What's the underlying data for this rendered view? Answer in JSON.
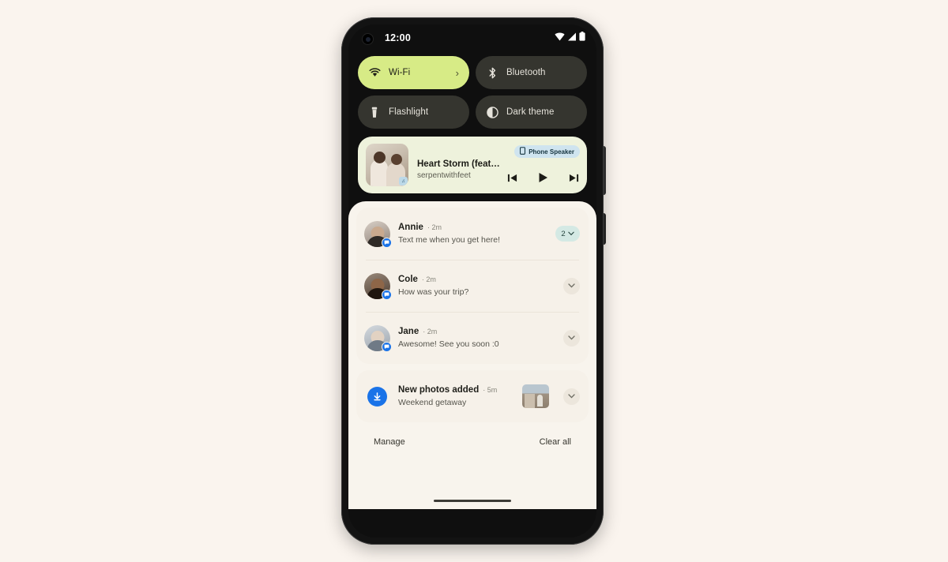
{
  "device": {
    "status_bar": {
      "time": "12:00",
      "icons": [
        "wifi-icon",
        "cellular-signal-icon",
        "battery-icon"
      ]
    }
  },
  "quick_settings": {
    "tiles": [
      {
        "label": "Wi-Fi",
        "icon": "wifi-icon",
        "active": true,
        "chevron": "›"
      },
      {
        "label": "Bluetooth",
        "icon": "bluetooth-icon",
        "active": false
      },
      {
        "label": "Flashlight",
        "icon": "flashlight-icon",
        "active": false
      },
      {
        "label": "Dark theme",
        "icon": "dark-theme-icon",
        "active": false
      }
    ]
  },
  "media_player": {
    "title": "Heart Storm (feat…",
    "artist": "serpentwithfeet",
    "output_chip": {
      "label": "Phone Speaker",
      "icon": "phone-speaker-icon"
    },
    "controls": {
      "previous": "skip-previous-icon",
      "play": "play-icon",
      "next": "skip-next-icon"
    }
  },
  "notifications": {
    "groups": [
      {
        "items": [
          {
            "name": "Annie",
            "time": "2m",
            "message": "Text me when you get here!",
            "avatar": "av-annie",
            "app_badge": "messages-icon",
            "count": "2",
            "expand": "chevron-down-icon"
          },
          {
            "name": "Cole",
            "time": "2m",
            "message": "How was your trip?",
            "avatar": "av-cole",
            "app_badge": "messages-icon",
            "expand": "chevron-down-icon"
          },
          {
            "name": "Jane",
            "time": "2m",
            "message": "Awesome! See you soon :0",
            "avatar": "av-jane",
            "app_badge": "messages-icon",
            "expand": "chevron-down-icon"
          }
        ]
      },
      {
        "items": [
          {
            "name": "New photos added",
            "time": "5m",
            "message": "Weekend getaway",
            "icon": "photos-backup-icon",
            "thumbnail": "weekend-getaway-thumbnail",
            "expand": "chevron-down-icon"
          }
        ]
      }
    ],
    "actions": {
      "manage": "Manage",
      "clear_all": "Clear all"
    }
  },
  "theme": {
    "page_background": "#faf4ee",
    "accent_lime": "#d7eb86",
    "tile_dark": "#35352f",
    "media_card": "#eef2dc",
    "shade_background": "#f8f4ed",
    "badge_mint": "#d4e9e4",
    "app_blue": "#1a73e8"
  }
}
